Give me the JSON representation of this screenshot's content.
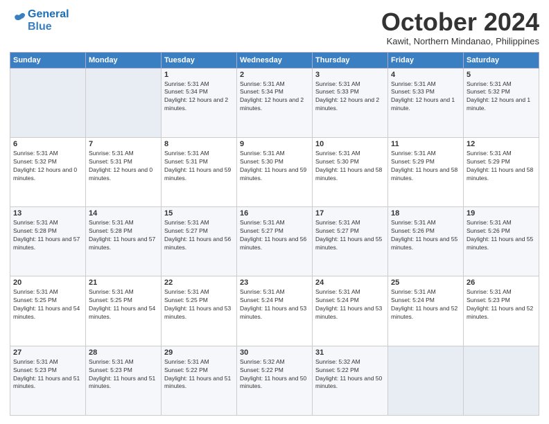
{
  "header": {
    "logo_line1": "General",
    "logo_line2": "Blue",
    "month_title": "October 2024",
    "location": "Kawit, Northern Mindanao, Philippines"
  },
  "days_of_week": [
    "Sunday",
    "Monday",
    "Tuesday",
    "Wednesday",
    "Thursday",
    "Friday",
    "Saturday"
  ],
  "weeks": [
    [
      {
        "day": "",
        "empty": true
      },
      {
        "day": "",
        "empty": true
      },
      {
        "day": "1",
        "sunrise": "Sunrise: 5:31 AM",
        "sunset": "Sunset: 5:34 PM",
        "daylight": "Daylight: 12 hours and 2 minutes."
      },
      {
        "day": "2",
        "sunrise": "Sunrise: 5:31 AM",
        "sunset": "Sunset: 5:34 PM",
        "daylight": "Daylight: 12 hours and 2 minutes."
      },
      {
        "day": "3",
        "sunrise": "Sunrise: 5:31 AM",
        "sunset": "Sunset: 5:33 PM",
        "daylight": "Daylight: 12 hours and 2 minutes."
      },
      {
        "day": "4",
        "sunrise": "Sunrise: 5:31 AM",
        "sunset": "Sunset: 5:33 PM",
        "daylight": "Daylight: 12 hours and 1 minute."
      },
      {
        "day": "5",
        "sunrise": "Sunrise: 5:31 AM",
        "sunset": "Sunset: 5:32 PM",
        "daylight": "Daylight: 12 hours and 1 minute."
      }
    ],
    [
      {
        "day": "6",
        "sunrise": "Sunrise: 5:31 AM",
        "sunset": "Sunset: 5:32 PM",
        "daylight": "Daylight: 12 hours and 0 minutes."
      },
      {
        "day": "7",
        "sunrise": "Sunrise: 5:31 AM",
        "sunset": "Sunset: 5:31 PM",
        "daylight": "Daylight: 12 hours and 0 minutes."
      },
      {
        "day": "8",
        "sunrise": "Sunrise: 5:31 AM",
        "sunset": "Sunset: 5:31 PM",
        "daylight": "Daylight: 11 hours and 59 minutes."
      },
      {
        "day": "9",
        "sunrise": "Sunrise: 5:31 AM",
        "sunset": "Sunset: 5:30 PM",
        "daylight": "Daylight: 11 hours and 59 minutes."
      },
      {
        "day": "10",
        "sunrise": "Sunrise: 5:31 AM",
        "sunset": "Sunset: 5:30 PM",
        "daylight": "Daylight: 11 hours and 58 minutes."
      },
      {
        "day": "11",
        "sunrise": "Sunrise: 5:31 AM",
        "sunset": "Sunset: 5:29 PM",
        "daylight": "Daylight: 11 hours and 58 minutes."
      },
      {
        "day": "12",
        "sunrise": "Sunrise: 5:31 AM",
        "sunset": "Sunset: 5:29 PM",
        "daylight": "Daylight: 11 hours and 58 minutes."
      }
    ],
    [
      {
        "day": "13",
        "sunrise": "Sunrise: 5:31 AM",
        "sunset": "Sunset: 5:28 PM",
        "daylight": "Daylight: 11 hours and 57 minutes."
      },
      {
        "day": "14",
        "sunrise": "Sunrise: 5:31 AM",
        "sunset": "Sunset: 5:28 PM",
        "daylight": "Daylight: 11 hours and 57 minutes."
      },
      {
        "day": "15",
        "sunrise": "Sunrise: 5:31 AM",
        "sunset": "Sunset: 5:27 PM",
        "daylight": "Daylight: 11 hours and 56 minutes."
      },
      {
        "day": "16",
        "sunrise": "Sunrise: 5:31 AM",
        "sunset": "Sunset: 5:27 PM",
        "daylight": "Daylight: 11 hours and 56 minutes."
      },
      {
        "day": "17",
        "sunrise": "Sunrise: 5:31 AM",
        "sunset": "Sunset: 5:27 PM",
        "daylight": "Daylight: 11 hours and 55 minutes."
      },
      {
        "day": "18",
        "sunrise": "Sunrise: 5:31 AM",
        "sunset": "Sunset: 5:26 PM",
        "daylight": "Daylight: 11 hours and 55 minutes."
      },
      {
        "day": "19",
        "sunrise": "Sunrise: 5:31 AM",
        "sunset": "Sunset: 5:26 PM",
        "daylight": "Daylight: 11 hours and 55 minutes."
      }
    ],
    [
      {
        "day": "20",
        "sunrise": "Sunrise: 5:31 AM",
        "sunset": "Sunset: 5:25 PM",
        "daylight": "Daylight: 11 hours and 54 minutes."
      },
      {
        "day": "21",
        "sunrise": "Sunrise: 5:31 AM",
        "sunset": "Sunset: 5:25 PM",
        "daylight": "Daylight: 11 hours and 54 minutes."
      },
      {
        "day": "22",
        "sunrise": "Sunrise: 5:31 AM",
        "sunset": "Sunset: 5:25 PM",
        "daylight": "Daylight: 11 hours and 53 minutes."
      },
      {
        "day": "23",
        "sunrise": "Sunrise: 5:31 AM",
        "sunset": "Sunset: 5:24 PM",
        "daylight": "Daylight: 11 hours and 53 minutes."
      },
      {
        "day": "24",
        "sunrise": "Sunrise: 5:31 AM",
        "sunset": "Sunset: 5:24 PM",
        "daylight": "Daylight: 11 hours and 53 minutes."
      },
      {
        "day": "25",
        "sunrise": "Sunrise: 5:31 AM",
        "sunset": "Sunset: 5:24 PM",
        "daylight": "Daylight: 11 hours and 52 minutes."
      },
      {
        "day": "26",
        "sunrise": "Sunrise: 5:31 AM",
        "sunset": "Sunset: 5:23 PM",
        "daylight": "Daylight: 11 hours and 52 minutes."
      }
    ],
    [
      {
        "day": "27",
        "sunrise": "Sunrise: 5:31 AM",
        "sunset": "Sunset: 5:23 PM",
        "daylight": "Daylight: 11 hours and 51 minutes."
      },
      {
        "day": "28",
        "sunrise": "Sunrise: 5:31 AM",
        "sunset": "Sunset: 5:23 PM",
        "daylight": "Daylight: 11 hours and 51 minutes."
      },
      {
        "day": "29",
        "sunrise": "Sunrise: 5:31 AM",
        "sunset": "Sunset: 5:22 PM",
        "daylight": "Daylight: 11 hours and 51 minutes."
      },
      {
        "day": "30",
        "sunrise": "Sunrise: 5:32 AM",
        "sunset": "Sunset: 5:22 PM",
        "daylight": "Daylight: 11 hours and 50 minutes."
      },
      {
        "day": "31",
        "sunrise": "Sunrise: 5:32 AM",
        "sunset": "Sunset: 5:22 PM",
        "daylight": "Daylight: 11 hours and 50 minutes."
      },
      {
        "day": "",
        "empty": true
      },
      {
        "day": "",
        "empty": true
      }
    ]
  ]
}
